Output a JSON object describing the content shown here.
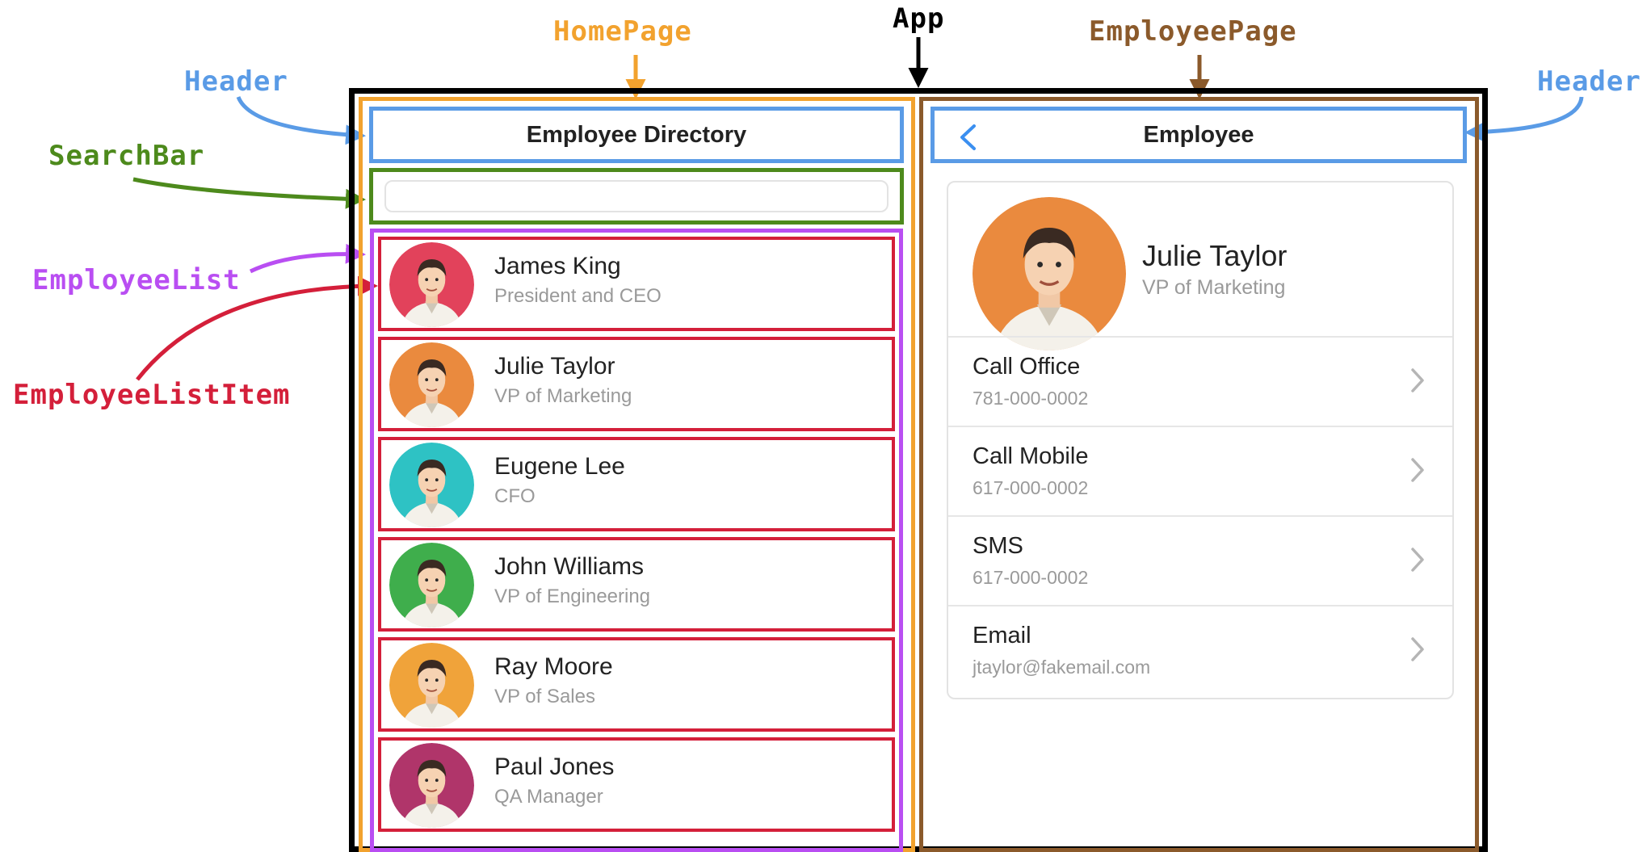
{
  "annotations": {
    "app": "App",
    "home_page": "HomePage",
    "employee_page": "EmployeePage",
    "header_left": "Header",
    "header_right": "Header",
    "search_bar": "SearchBar",
    "employee_list": "EmployeeList",
    "employee_list_item": "EmployeeListItem"
  },
  "colors": {
    "app": "#000000",
    "home_page": "#f2a22e",
    "employee_page": "#8b5a2b",
    "header": "#5a9be6",
    "search_bar": "#4d8a1c",
    "employee_list": "#b94ef2",
    "employee_list_item": "#d41f3a",
    "back_chevron": "#3b8ff0"
  },
  "home": {
    "header_title": "Employee Directory",
    "search": {
      "value": "",
      "placeholder": ""
    },
    "employees": [
      {
        "name": "James King",
        "title": "President and CEO",
        "avatar_bg": "#e2425b",
        "avatar_icon": "person-avatar-icon"
      },
      {
        "name": "Julie Taylor",
        "title": "VP of Marketing",
        "avatar_bg": "#ea8a3e",
        "avatar_icon": "person-avatar-icon"
      },
      {
        "name": "Eugene Lee",
        "title": "CFO",
        "avatar_bg": "#2ec2c4",
        "avatar_icon": "person-avatar-icon"
      },
      {
        "name": "John Williams",
        "title": "VP of Engineering",
        "avatar_bg": "#3fae4c",
        "avatar_icon": "person-avatar-icon"
      },
      {
        "name": "Ray Moore",
        "title": "VP of Sales",
        "avatar_bg": "#f0a33a",
        "avatar_icon": "person-avatar-icon"
      },
      {
        "name": "Paul Jones",
        "title": "QA Manager",
        "avatar_bg": "#b0356a",
        "avatar_icon": "person-avatar-icon"
      }
    ]
  },
  "employee": {
    "header_title": "Employee",
    "back_icon": "chevron-left-icon",
    "name": "Julie Taylor",
    "title": "VP of Marketing",
    "avatar_bg": "#ea8a3e",
    "actions": [
      {
        "label": "Call Office",
        "value": "781-000-0002",
        "icon": "chevron-right-icon"
      },
      {
        "label": "Call Mobile",
        "value": "617-000-0002",
        "icon": "chevron-right-icon"
      },
      {
        "label": "SMS",
        "value": "617-000-0002",
        "icon": "chevron-right-icon"
      },
      {
        "label": "Email",
        "value": "jtaylor@fakemail.com",
        "icon": "chevron-right-icon"
      }
    ]
  }
}
